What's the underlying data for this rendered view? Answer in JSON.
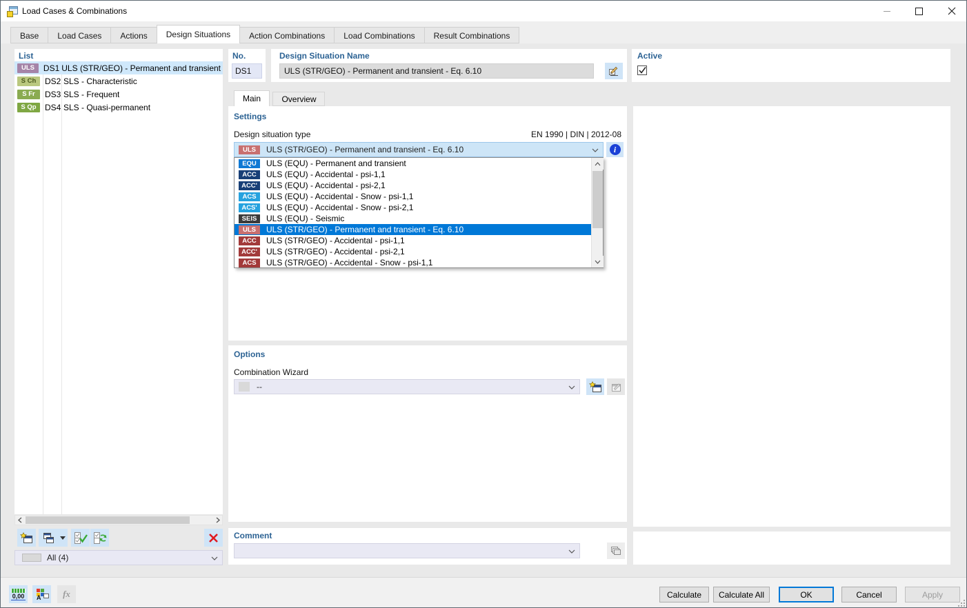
{
  "window": {
    "title": "Load Cases & Combinations"
  },
  "tabs": {
    "items": [
      {
        "label": "Base"
      },
      {
        "label": "Load Cases"
      },
      {
        "label": "Actions"
      },
      {
        "label": "Design Situations"
      },
      {
        "label": "Action Combinations"
      },
      {
        "label": "Load Combinations"
      },
      {
        "label": "Result Combinations"
      }
    ],
    "active_index": 3
  },
  "list": {
    "header": "List",
    "items": [
      {
        "badge": "ULS",
        "badge_bg": "#a584a8",
        "badge_fg": "#ffffff",
        "no": "DS1",
        "name": "ULS (STR/GEO) - Permanent and transient - E",
        "selected": true
      },
      {
        "badge": "S Ch",
        "badge_bg": "#bac87f",
        "badge_fg": "#4c5a1e",
        "no": "DS2",
        "name": "SLS - Characteristic",
        "selected": false
      },
      {
        "badge": "S Fr",
        "badge_bg": "#8aab51",
        "badge_fg": "#ffffff",
        "no": "DS3",
        "name": "SLS - Frequent",
        "selected": false
      },
      {
        "badge": "S Qp",
        "badge_bg": "#7fa743",
        "badge_fg": "#ffffff",
        "no": "DS4",
        "name": "SLS - Quasi-permanent",
        "selected": false
      }
    ],
    "filter": {
      "label": "All (4)",
      "swatch_color": "#d9d9d9"
    }
  },
  "identity": {
    "no_label": "No.",
    "no_value": "DS1",
    "name_label": "Design Situation Name",
    "name_value": "ULS (STR/GEO) - Permanent and transient - Eq. 6.10",
    "active_label": "Active",
    "active_checked": true
  },
  "subtabs": [
    {
      "label": "Main"
    },
    {
      "label": "Overview"
    }
  ],
  "settings": {
    "header": "Settings",
    "type_label": "Design situation type",
    "standard": "EN 1990 | DIN | 2012-08",
    "info_glyph": "i",
    "selected": {
      "badge": "ULS",
      "badge_bg": "#c87070",
      "badge_fg": "#ffffff",
      "text": "ULS (STR/GEO) - Permanent and transient - Eq. 6.10"
    },
    "dropdown_items": [
      {
        "badge": "EQU",
        "badge_bg": "#0f79d4",
        "text": "ULS (EQU) - Permanent and transient",
        "selected": false
      },
      {
        "badge": "ACC",
        "badge_bg": "#183f77",
        "text": "ULS (EQU) - Accidental - psi-1,1",
        "selected": false
      },
      {
        "badge": "ACC'",
        "badge_bg": "#183f77",
        "text": "ULS (EQU) - Accidental - psi-2,1",
        "selected": false
      },
      {
        "badge": "ACS",
        "badge_bg": "#26a2df",
        "text": "ULS (EQU) - Accidental - Snow - psi-1,1",
        "selected": false
      },
      {
        "badge": "ACS'",
        "badge_bg": "#26a2df",
        "text": "ULS (EQU) - Accidental - Snow - psi-2,1",
        "selected": false
      },
      {
        "badge": "SEIS",
        "badge_bg": "#3b3b3b",
        "text": "ULS (EQU) - Seismic",
        "selected": false
      },
      {
        "badge": "ULS",
        "badge_bg": "#c87070",
        "text": "ULS (STR/GEO) - Permanent and transient - Eq. 6.10",
        "selected": true
      },
      {
        "badge": "ACC",
        "badge_bg": "#a23a3a",
        "text": "ULS (STR/GEO) - Accidental - psi-1,1",
        "selected": false
      },
      {
        "badge": "ACC'",
        "badge_bg": "#a23a3a",
        "text": "ULS (STR/GEO) - Accidental - psi-2,1",
        "selected": false
      },
      {
        "badge": "ACS",
        "badge_bg": "#a23a3a",
        "text": "ULS (STR/GEO) - Accidental - Snow - psi-1,1",
        "selected": false
      }
    ]
  },
  "options": {
    "header": "Options",
    "wizard_label": "Combination Wizard",
    "wizard_value": "--",
    "wizard_swatch": "#d9d9d9"
  },
  "comment": {
    "header": "Comment",
    "value": ""
  },
  "footer": {
    "units_label": "0,00",
    "fx_label": "fx",
    "buttons": [
      {
        "label": "Calculate",
        "state": "normal"
      },
      {
        "label": "Calculate All",
        "state": "normal"
      },
      {
        "label": "OK",
        "state": "default"
      },
      {
        "label": "Cancel",
        "state": "normal"
      },
      {
        "label": "Apply",
        "state": "disabled"
      }
    ]
  },
  "colors": {
    "accent": "#0078d7",
    "selection_light": "#cfe8fb",
    "header_blue": "#2d6394"
  }
}
